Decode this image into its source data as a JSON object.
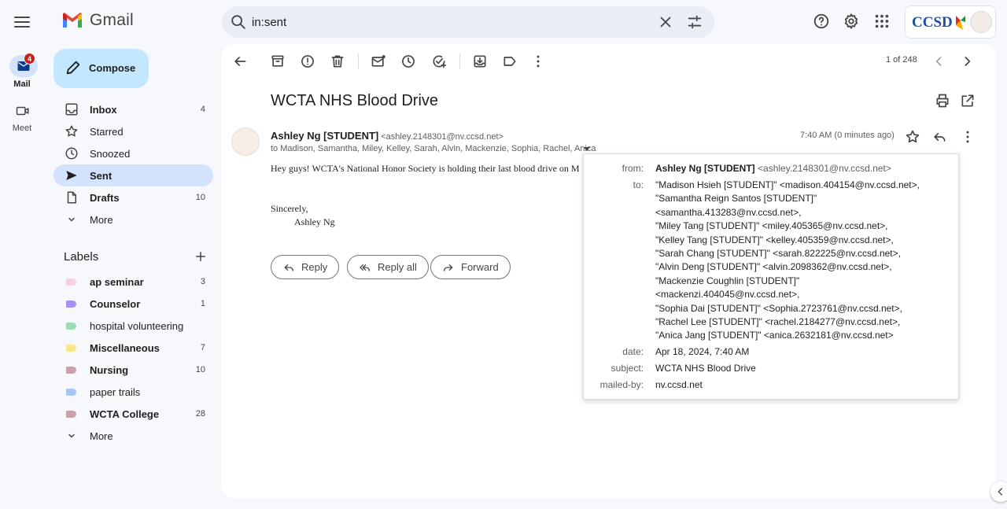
{
  "app": {
    "name": "Gmail"
  },
  "search": {
    "query": "in:sent"
  },
  "account": {
    "org_logo_text": "CCSD"
  },
  "rail": {
    "mail_label": "Mail",
    "mail_badge": "4",
    "meet_label": "Meet"
  },
  "compose": {
    "label": "Compose"
  },
  "nav": {
    "inbox": {
      "label": "Inbox",
      "count": "4"
    },
    "starred": {
      "label": "Starred"
    },
    "snoozed": {
      "label": "Snoozed"
    },
    "sent": {
      "label": "Sent"
    },
    "drafts": {
      "label": "Drafts",
      "count": "10"
    },
    "more": {
      "label": "More"
    }
  },
  "labels": {
    "title": "Labels",
    "more_label": "More",
    "items": [
      {
        "name": "ap seminar",
        "count": "3",
        "color": "#f6d0e2",
        "bold": true
      },
      {
        "name": "Counselor",
        "count": "1",
        "color": "#a58ff0",
        "bold": true
      },
      {
        "name": "hospital volunteering",
        "count": "",
        "color": "#9fd9b5",
        "bold": false
      },
      {
        "name": "Miscellaneous",
        "count": "7",
        "color": "#fce68a",
        "bold": true
      },
      {
        "name": "Nursing",
        "count": "10",
        "color": "#c9a2a9",
        "bold": true
      },
      {
        "name": "paper trails",
        "count": "",
        "color": "#a9c6f5",
        "bold": false
      },
      {
        "name": "WCTA College",
        "count": "28",
        "color": "#c9a2a9",
        "bold": true
      }
    ]
  },
  "toolbar": {
    "pager": "1 of 248"
  },
  "email": {
    "subject": "WCTA NHS Blood Drive",
    "sender_name": "Ashley Ng [STUDENT]",
    "sender_email": "<ashley.2148301@nv.ccsd.net>",
    "to_line": "to Madison, Samantha, Miley, Kelley, Sarah, Alvin, Mackenzie, Sophia, Rachel, Anica",
    "time": "7:40 AM (0 minutes ago)",
    "body": "Hey guys! WCTA's National Honor Society is holding their last blood drive on M",
    "closing": "Sincerely,",
    "signature": "Ashley Ng",
    "actions": {
      "reply": "Reply",
      "reply_all": "Reply all",
      "forward": "Forward"
    }
  },
  "details": {
    "from_key": "from:",
    "from_name": "Ashley Ng [STUDENT]",
    "from_email": "<ashley.2148301@nv.ccsd.net>",
    "to_key": "to:",
    "to_lines": [
      "\"Madison Hsieh [STUDENT]\" <madison.404154@nv.ccsd.net>,",
      "\"Samantha Reign Santos [STUDENT]\"",
      "<samantha.413283@nv.ccsd.net>,",
      "\"Miley Tang [STUDENT]\" <miley.405365@nv.ccsd.net>,",
      "\"Kelley Tang [STUDENT]\" <kelley.405359@nv.ccsd.net>,",
      "\"Sarah Chang [STUDENT]\" <sarah.822225@nv.ccsd.net>,",
      "\"Alvin Deng [STUDENT]\" <alvin.2098362@nv.ccsd.net>,",
      "\"Mackenzie Coughlin [STUDENT]\"",
      "<mackenzi.404045@nv.ccsd.net>,",
      "\"Sophia Dai [STUDENT]\" <Sophia.2723761@nv.ccsd.net>,",
      "\"Rachel Lee [STUDENT]\" <rachel.2184277@nv.ccsd.net>,",
      "\"Anica Jang [STUDENT]\" <anica.2632181@nv.ccsd.net>"
    ],
    "date_key": "date:",
    "date": "Apr 18, 2024, 7:40 AM",
    "subject_key": "subject:",
    "subject": "WCTA NHS Blood Drive",
    "mailed_by_key": "mailed-by:",
    "mailed_by": "nv.ccsd.net"
  }
}
